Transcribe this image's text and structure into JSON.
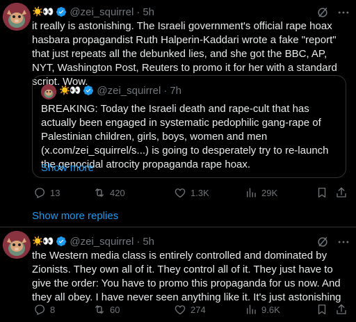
{
  "post1": {
    "emoji": "☀️👀",
    "handle": "@zei_squirrel",
    "time": "5h",
    "text": "it really is astonishing. The Israeli government's official rape hoax hasbara propagandist Ruth Halperin-Kaddari wrote a fake \"report\" that just repeats all the debunked lies, and she got the BBC, AP, NYT, Washington Post, Reuters to promo it for her with a standard script. Wow.",
    "quote": {
      "emoji": "☀️👀",
      "handle": "@zei_squirrel",
      "time": "7h",
      "text": "BREAKING: Today the Israeli death and rape-cult that has actually been engaged in systematic pedophilic gang-rape of Palestinian children, girls, boys, women and men (x.com/zei_squirrel/s...) is going to desperately try to re-launch the genocidal atrocity propaganda rape hoax.",
      "show_more": "Show more"
    },
    "stats": {
      "replies": "13",
      "reposts": "420",
      "likes": "1.3K",
      "views": "29K"
    }
  },
  "show_more_replies": "Show more replies",
  "post2": {
    "emoji": "☀️👀",
    "handle": "@zei_squirrel",
    "time": "5h",
    "text": "the Western media class is entirely controlled and dominated by Zionists. They own all of it. They control all of it. They just have to give the order: You have to promo this propaganda for us now. And they all obey. I have never seen anything like it. It's just astonishing",
    "stats": {
      "replies": "8",
      "reposts": "60",
      "likes": "274",
      "views": "9.6K"
    }
  },
  "colors": {
    "accent": "#1d9bf0",
    "muted": "#71767b",
    "text": "#e7e9ea",
    "border": "#2f3336"
  },
  "icons": [
    "verified-icon",
    "grok-icon",
    "more-icon",
    "reply-icon",
    "repost-icon",
    "like-icon",
    "views-icon",
    "bookmark-icon",
    "share-icon"
  ]
}
